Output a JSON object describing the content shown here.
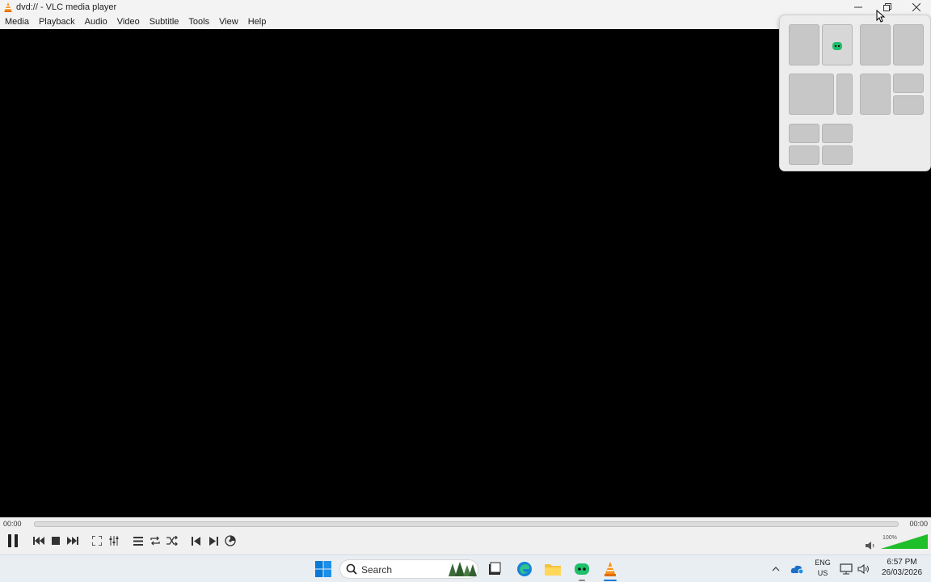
{
  "window": {
    "title": "dvd:// - VLC media player",
    "accent": "#f7931e"
  },
  "menu": [
    "Media",
    "Playback",
    "Audio",
    "Video",
    "Subtitle",
    "Tools",
    "View",
    "Help"
  ],
  "player": {
    "time_elapsed": "00:00",
    "time_total": "00:00",
    "progress": 0,
    "volume_label": "100%",
    "volume_level": 1.0,
    "volume_color": "#1fbf2a"
  },
  "taskbar": {
    "search_label": "Search",
    "lang": "ENG",
    "region": "US",
    "time": "6:57 PM",
    "date": "26/03/2026"
  }
}
